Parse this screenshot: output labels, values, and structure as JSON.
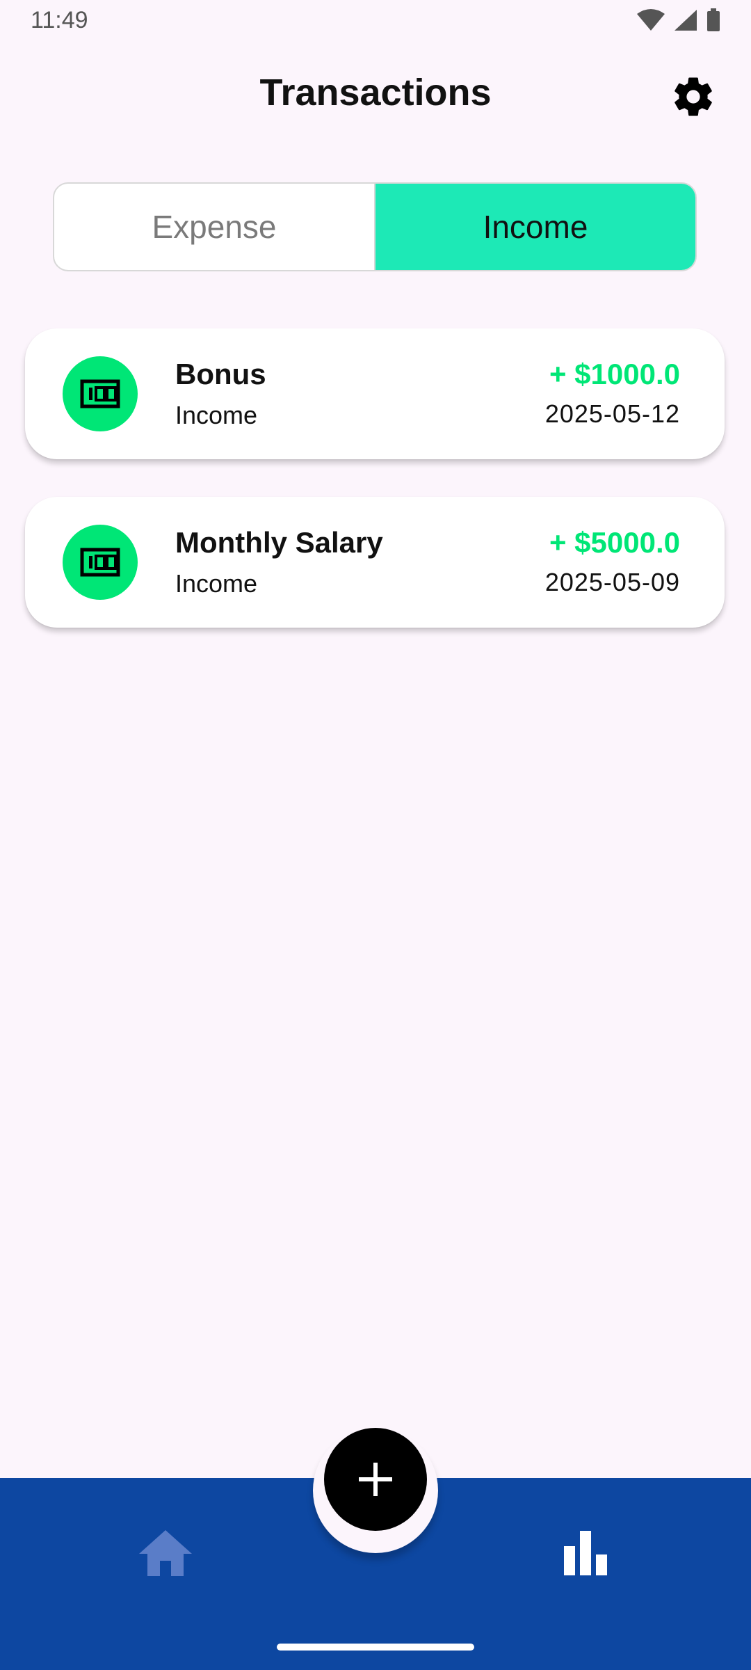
{
  "status_bar": {
    "time": "11:49",
    "icons": [
      "wifi-icon",
      "signal-icon",
      "battery-icon"
    ]
  },
  "header": {
    "title": "Transactions",
    "settings_icon": "gear-icon"
  },
  "tabs": [
    {
      "label": "Expense",
      "selected": false
    },
    {
      "label": "Income",
      "selected": true
    }
  ],
  "transactions": [
    {
      "title": "Bonus",
      "category": "Income",
      "amount": "+ $1000.0",
      "date": "2025-05-12",
      "icon": "money-icon"
    },
    {
      "title": "Monthly Salary",
      "category": "Income",
      "amount": "+ $5000.0",
      "date": "2025-05-09",
      "icon": "money-icon"
    }
  ],
  "bottom_nav": {
    "items": [
      "home-icon",
      "add-icon",
      "bar-chart-icon"
    ]
  },
  "colors": {
    "accent_teal": "#1de9b6",
    "income_green": "#00e676",
    "nav_blue": "#0d47a1",
    "background": "#fcf5fc"
  }
}
